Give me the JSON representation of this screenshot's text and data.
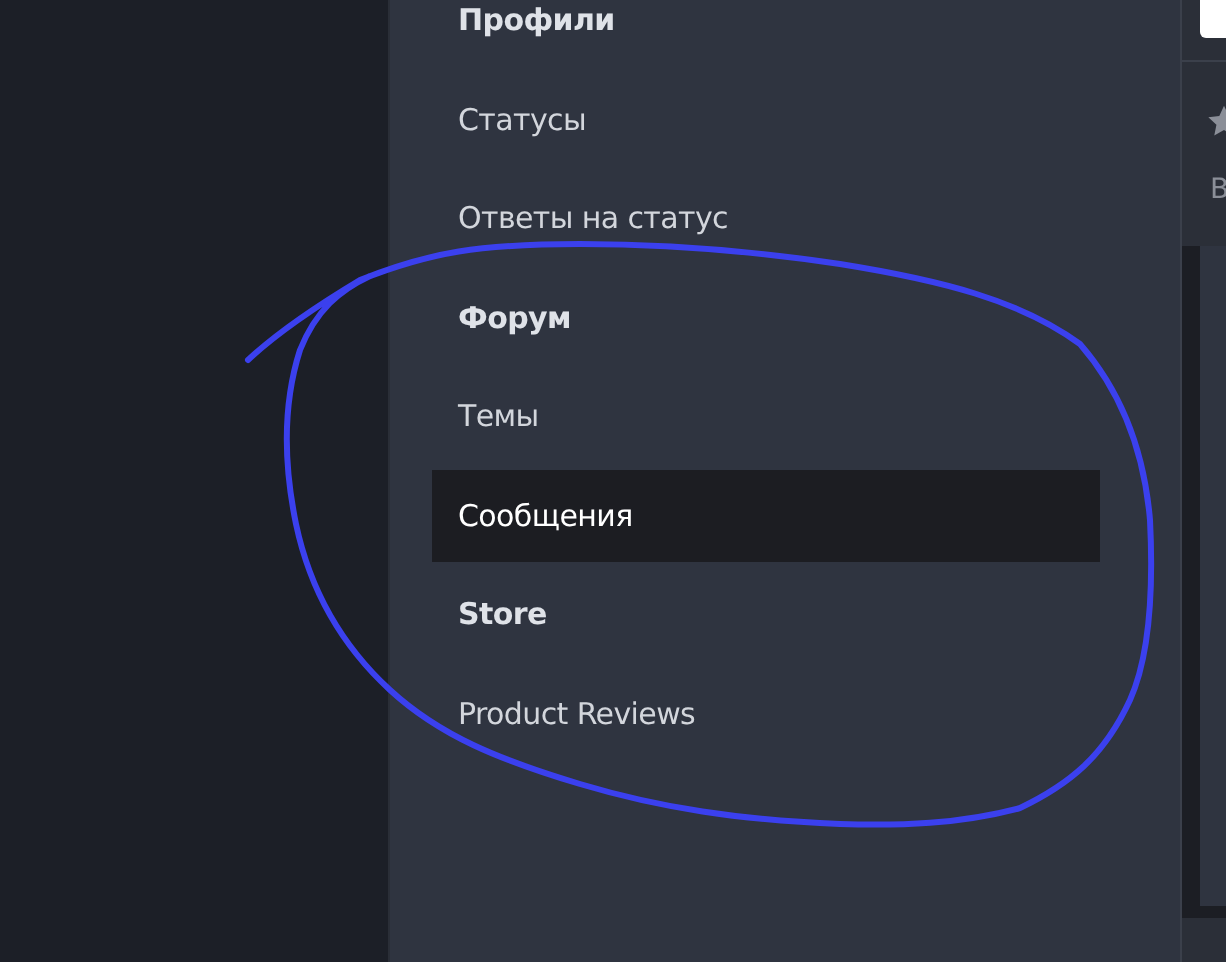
{
  "menu": {
    "groups": [
      {
        "title": "Профили",
        "items": [
          {
            "label": "Статусы",
            "selected": false
          },
          {
            "label": "Ответы на статус",
            "selected": false
          }
        ]
      },
      {
        "title": "Форум",
        "items": [
          {
            "label": "Темы",
            "selected": false
          },
          {
            "label": "Сообщения",
            "selected": true
          }
        ]
      },
      {
        "title": "Store",
        "items": [
          {
            "label": "Product Reviews",
            "selected": false
          }
        ]
      }
    ]
  },
  "side_panel": {
    "caption": "В"
  }
}
